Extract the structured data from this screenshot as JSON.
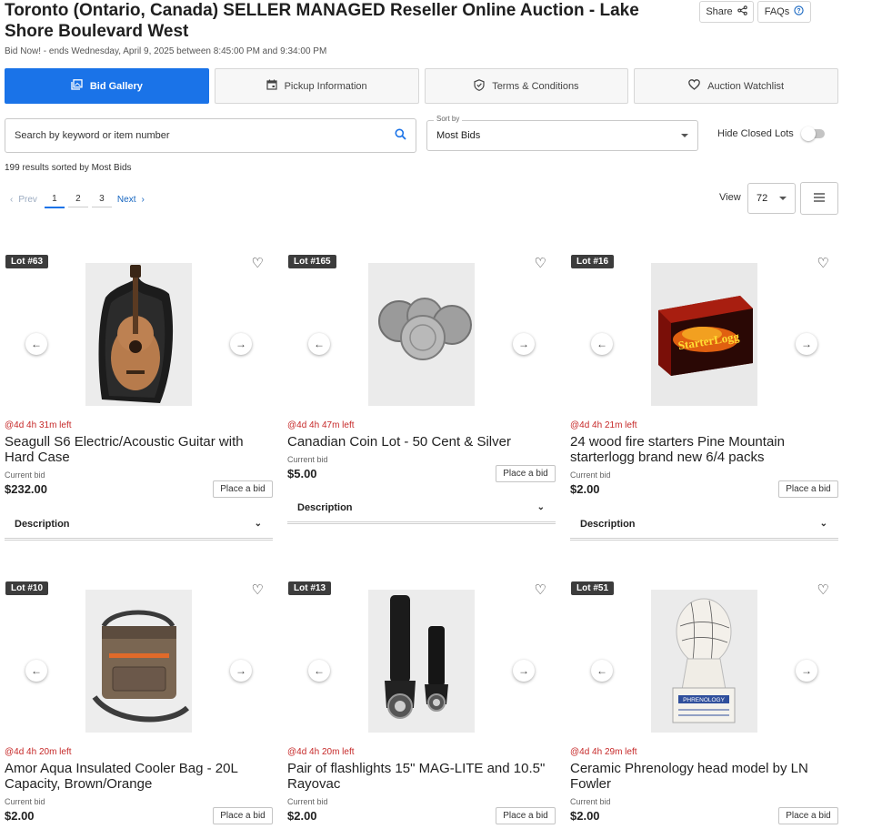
{
  "header": {
    "title": "Toronto (Ontario, Canada) SELLER MANAGED Reseller Online Auction - Lake Shore Boulevard West",
    "subtitle": "Bid Now! - ends Wednesday, April 9, 2025 between 8:45:00 PM and 9:34:00 PM",
    "share_label": "Share",
    "faqs_label": "FAQs"
  },
  "tabs": [
    {
      "label": "Bid Gallery",
      "icon": "gallery-icon",
      "active": true
    },
    {
      "label": "Pickup Information",
      "icon": "calendar-icon",
      "active": false
    },
    {
      "label": "Terms & Conditions",
      "icon": "shield-icon",
      "active": false
    },
    {
      "label": "Auction Watchlist",
      "icon": "heart-icon",
      "active": false
    }
  ],
  "search": {
    "placeholder": "Search by keyword or item number"
  },
  "sort": {
    "label": "Sort by",
    "value": "Most Bids"
  },
  "filter": {
    "hide_closed_label": "Hide Closed Lots",
    "hide_closed_on": false
  },
  "results_text": "199 results sorted by Most Bids",
  "pagination": {
    "prev": "Prev",
    "pages": [
      "1",
      "2",
      "3"
    ],
    "current": "1",
    "next": "Next"
  },
  "view": {
    "label": "View",
    "value": "72"
  },
  "lots": [
    {
      "badge": "Lot #63",
      "time_left": "@4d 4h 31m left",
      "title": "Seagull S6 Electric/Acoustic Guitar with Hard Case",
      "current_bid_label": "Current bid",
      "current_bid": "$232.00",
      "place_bid": "Place a bid",
      "description": "Description",
      "image": "guitar"
    },
    {
      "badge": "Lot #165",
      "time_left": "@4d 4h 47m left",
      "title": "Canadian Coin Lot - 50 Cent & Silver",
      "current_bid_label": "Current bid",
      "current_bid": "$5.00",
      "place_bid": "Place a bid",
      "description": "Description",
      "image": "coins"
    },
    {
      "badge": "Lot #16",
      "time_left": "@4d 4h 21m left",
      "title": "24 wood fire starters Pine Mountain starterlogg brand new 6/4 packs",
      "current_bid_label": "Current bid",
      "current_bid": "$2.00",
      "place_bid": "Place a bid",
      "description": "Description",
      "image": "starterlogg",
      "image_text": "StarterLogg"
    },
    {
      "badge": "Lot #10",
      "time_left": "@4d 4h 20m left",
      "title": "Amor Aqua Insulated Cooler Bag - 20L Capacity, Brown/Orange",
      "current_bid_label": "Current bid",
      "current_bid": "$2.00",
      "place_bid": "Place a bid",
      "image": "cooler-bag"
    },
    {
      "badge": "Lot #13",
      "time_left": "@4d 4h 20m left",
      "title": "Pair of flashlights 15\" MAG-LITE and 10.5\" Rayovac",
      "current_bid_label": "Current bid",
      "current_bid": "$2.00",
      "place_bid": "Place a bid",
      "image": "flashlights"
    },
    {
      "badge": "Lot #51",
      "time_left": "@4d 4h 29m left",
      "title": "Ceramic Phrenology head model by LN Fowler",
      "current_bid_label": "Current bid",
      "current_bid": "$2.00",
      "place_bid": "Place a bid",
      "image": "phrenology-head",
      "image_text": "PHRENOLOGY"
    }
  ]
}
